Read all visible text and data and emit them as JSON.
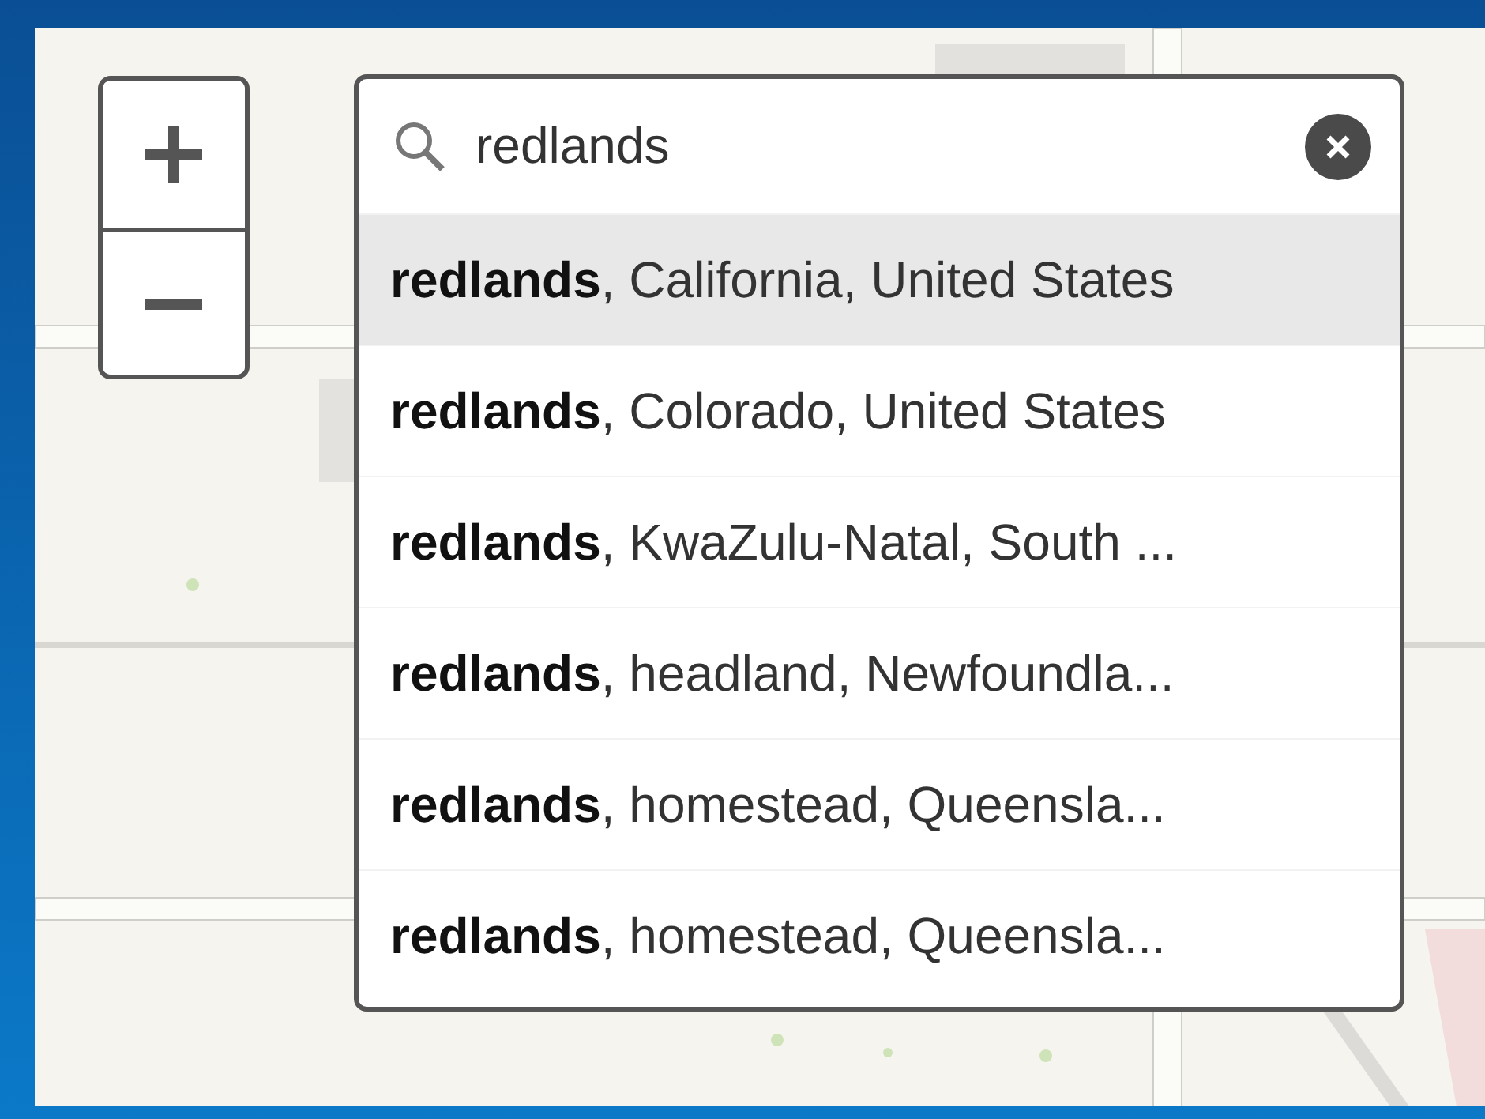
{
  "zoom_controls": [
    {
      "kind": "zoom-in"
    },
    {
      "kind": "zoom-out"
    }
  ],
  "search": {
    "value": "redlands",
    "suggestions": [
      {
        "text": "**redlands**, California, United States",
        "selected": true
      },
      {
        "text": "**redlands**, Colorado, United States",
        "selected": false
      },
      {
        "text": "**redlands**, KwaZulu-Natal, South ...",
        "selected": false
      },
      {
        "text": "**redlands**, headland, Newfoundla...",
        "selected": false
      },
      {
        "text": "**redlands**, homestead, Queensla...",
        "selected": false
      },
      {
        "text": "**redlands**, homestead, Queensla...",
        "selected": false
      }
    ]
  }
}
